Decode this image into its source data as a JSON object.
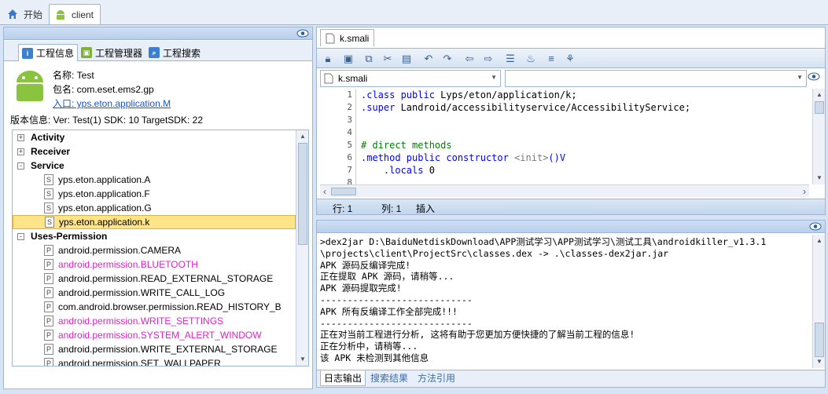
{
  "top_tabs": [
    {
      "label": "开始"
    },
    {
      "label": "client"
    }
  ],
  "left_panel": {
    "tabs": [
      {
        "label": "工程信息"
      },
      {
        "label": "工程管理器"
      },
      {
        "label": "工程搜索"
      }
    ],
    "info": {
      "name": "名称: Test",
      "package": "包名: com.eset.ems2.gp",
      "entry": "入口: yps.eton.application.M",
      "version": "版本信息: Ver: Test(1) SDK: 10 TargetSDK: 22"
    },
    "tree": [
      {
        "label": "Activity",
        "type": "group",
        "expander": "+"
      },
      {
        "label": "Receiver",
        "type": "group",
        "expander": "+"
      },
      {
        "label": "Service",
        "type": "group",
        "expander": "-"
      },
      {
        "label": "yps.eton.application.A",
        "type": "smali"
      },
      {
        "label": "yps.eton.application.F",
        "type": "smali"
      },
      {
        "label": "yps.eton.application.G",
        "type": "smali"
      },
      {
        "label": "yps.eton.application.k",
        "type": "smali",
        "selected": true
      },
      {
        "label": "Uses-Permission",
        "type": "group",
        "expander": "-"
      },
      {
        "label": "android.permission.CAMERA",
        "type": "perm"
      },
      {
        "label": "android.permission.BLUETOOTH",
        "type": "perm",
        "highlight": true
      },
      {
        "label": "android.permission.READ_EXTERNAL_STORAGE",
        "type": "perm"
      },
      {
        "label": "android.permission.WRITE_CALL_LOG",
        "type": "perm"
      },
      {
        "label": "com.android.browser.permission.READ_HISTORY_B",
        "type": "perm"
      },
      {
        "label": "android.permission.WRITE_SETTINGS",
        "type": "perm",
        "highlight": true
      },
      {
        "label": "android.permission.SYSTEM_ALERT_WINDOW",
        "type": "perm",
        "highlight": true
      },
      {
        "label": "android.permission.WRITE_EXTERNAL_STORAGE",
        "type": "perm"
      },
      {
        "label": "android.permission.SET_WALLPAPER",
        "type": "perm"
      }
    ]
  },
  "editor": {
    "tab_label": "k.smali",
    "file_combo": "k.smali",
    "member_combo": "",
    "lines": [
      {
        "n": "1",
        "parts": [
          {
            "t": ".class public",
            "c": "kw"
          },
          {
            "t": " Lyps/eton/application/k;",
            "c": ""
          }
        ]
      },
      {
        "n": "2",
        "parts": [
          {
            "t": ".super",
            "c": "kw"
          },
          {
            "t": " Landroid/accessibilityservice/AccessibilityService;",
            "c": ""
          }
        ]
      },
      {
        "n": "3",
        "parts": []
      },
      {
        "n": "4",
        "parts": []
      },
      {
        "n": "5",
        "parts": [
          {
            "t": "# direct methods",
            "c": "cm"
          }
        ]
      },
      {
        "n": "6",
        "parts": [
          {
            "t": ".method public constructor",
            "c": "kw"
          },
          {
            "t": " <init>",
            "c": "gr"
          },
          {
            "t": "()V",
            "c": "kw"
          }
        ]
      },
      {
        "n": "7",
        "parts": [
          {
            "t": "    .locals",
            "c": "kw"
          },
          {
            "t": " 0",
            "c": ""
          }
        ]
      },
      {
        "n": "8",
        "parts": []
      }
    ],
    "status": {
      "row": "行: 1",
      "col": "列: 1",
      "mode": "插入"
    }
  },
  "log": {
    "lines": [
      ">dex2jar D:\\BaiduNetdiskDownload\\APP测试学习\\APP测试学习\\测试工具\\androidkiller_v1.3.1",
      "\\projects\\client\\ProjectSrc\\classes.dex -> .\\classes-dex2jar.jar",
      "APK 源码反编译完成!",
      "正在提取 APK 源码，请稍等...",
      "APK 源码提取完成!",
      "----------------------------",
      "APK 所有反编译工作全部完成!!!",
      "----------------------------",
      "正在对当前工程进行分析, 这将有助于您更加方便快捷的了解当前工程的信息!",
      "正在分析中，请稍等...",
      "该 APK 未检测到其他信息"
    ],
    "tabs": [
      {
        "label": "日志输出"
      },
      {
        "label": "搜索结果"
      },
      {
        "label": "方法引用"
      }
    ]
  }
}
